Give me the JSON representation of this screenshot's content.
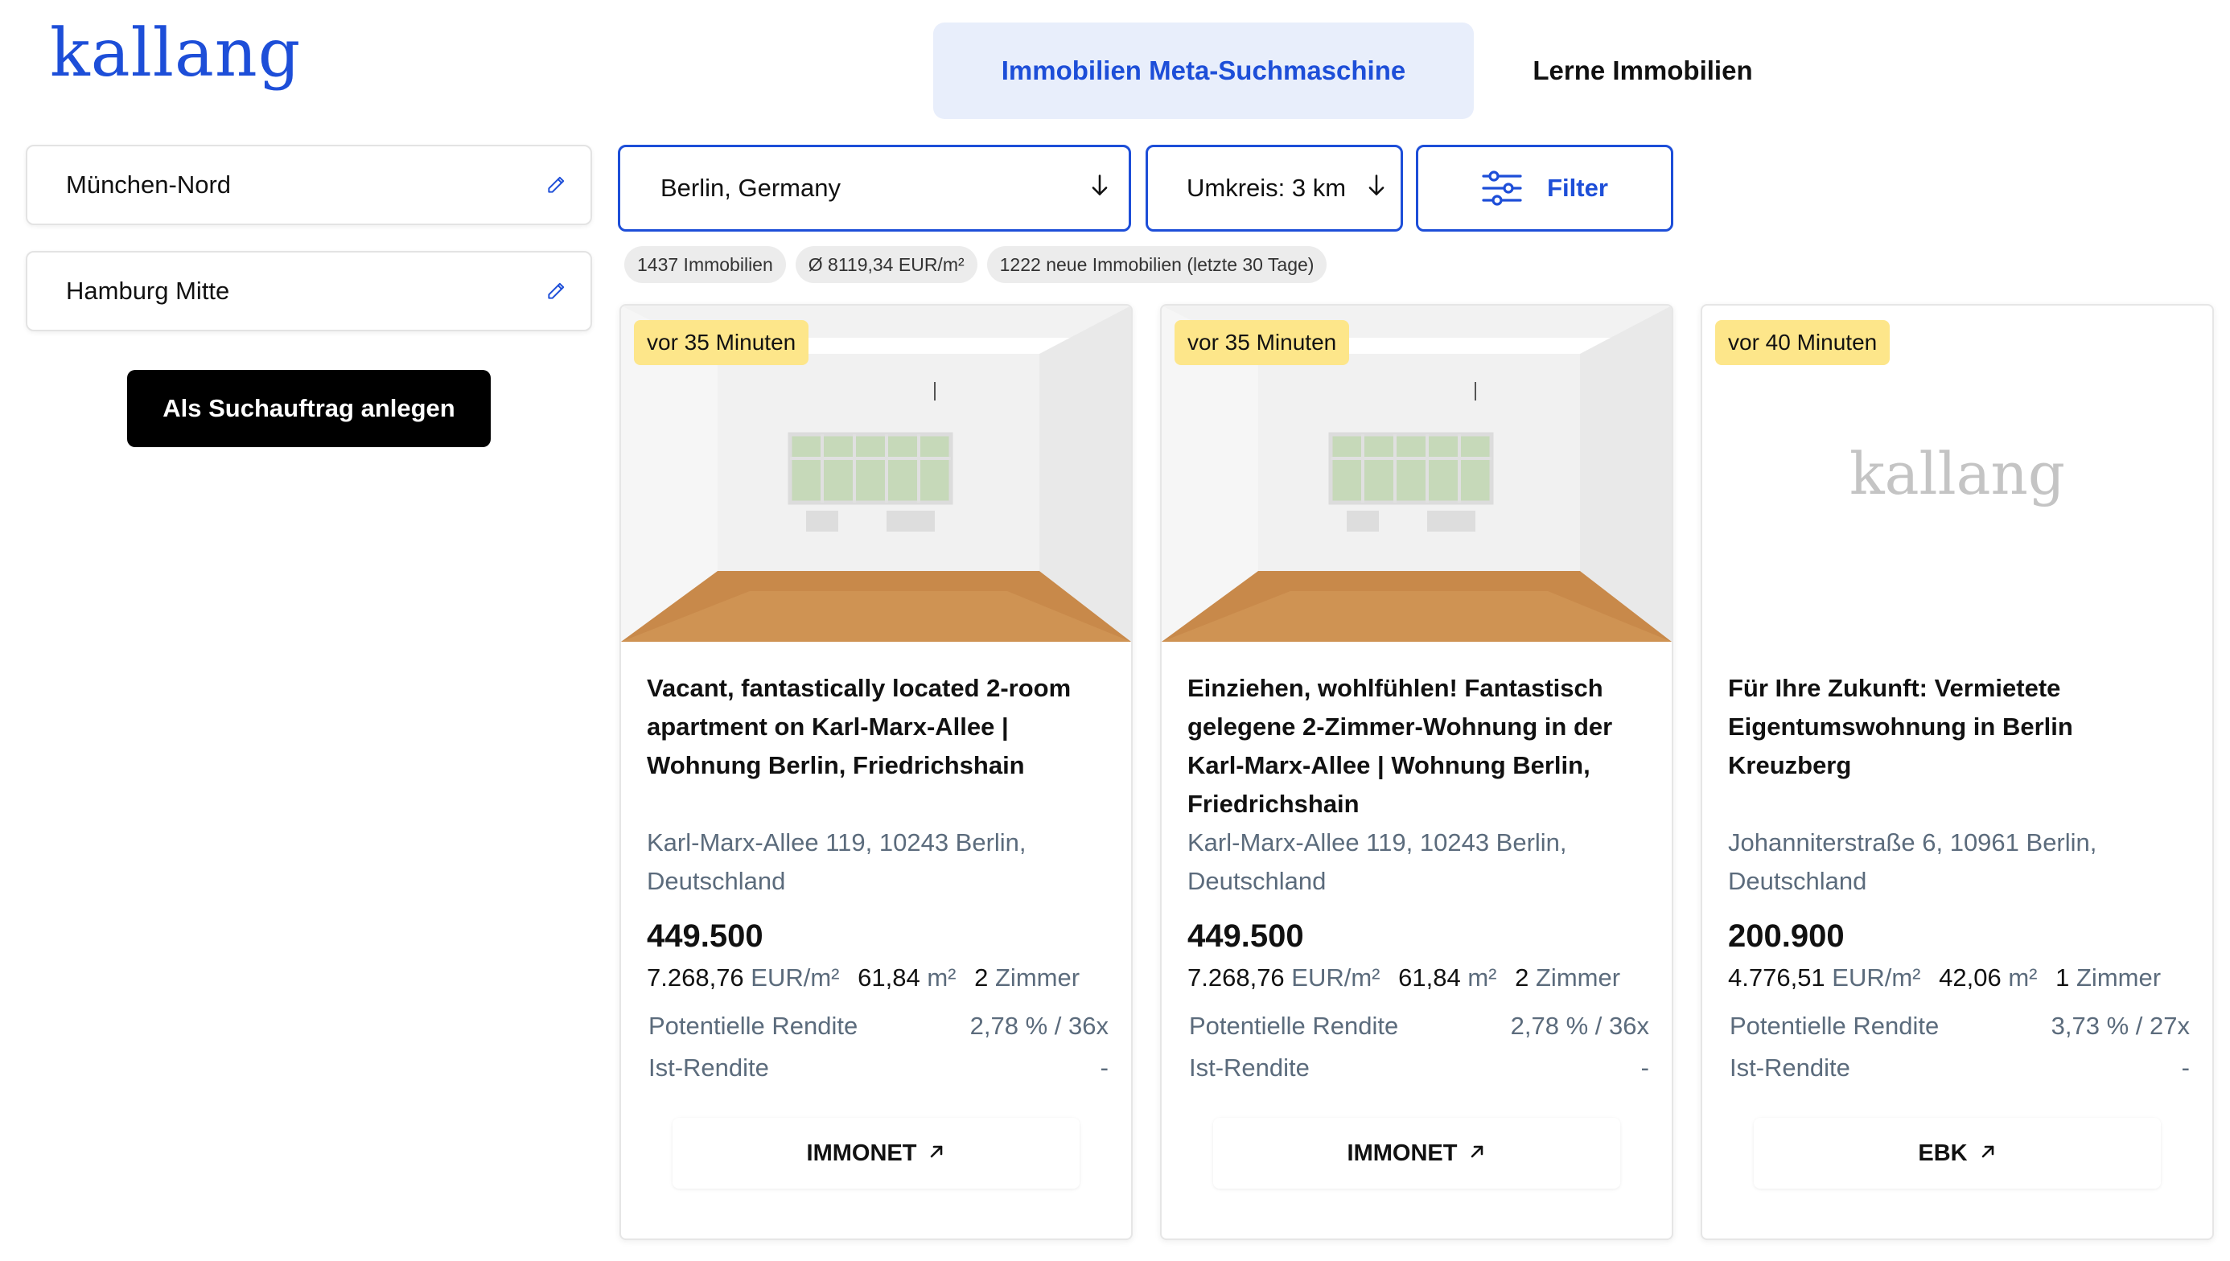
{
  "brand": {
    "logo_text": "kallang",
    "accent": "#1d4ed8"
  },
  "topnav": {
    "tabs": [
      {
        "label": "Immobilien Meta-Suchmaschine",
        "active": true
      },
      {
        "label": "Lerne Immobilien",
        "active": false
      }
    ]
  },
  "sidebar": {
    "saved_searches": [
      {
        "label": "München-Nord",
        "icon": "pencil-icon"
      },
      {
        "label": "Hamburg Mitte",
        "icon": "pencil-icon"
      }
    ],
    "create_button": "Als Suchauftrag anlegen"
  },
  "search": {
    "location": "Berlin, Germany",
    "radius": "Umkreis: 3 km",
    "filter_label": "Filter",
    "stats": [
      "1437 Immobilien",
      "Ø 8119,34 EUR/m²",
      "1222 neue Immobilien (letzte 30 Tage)"
    ]
  },
  "listings": [
    {
      "age": "vor 35 Minuten",
      "image": "empty-room-photo",
      "title": "Vacant, fantastically located 2-room apartment on Karl-Marx-Allee | Wohnung Berlin, Friedrichshain",
      "address": "Karl-Marx-Allee 119, 10243 Berlin, Deutschland",
      "price": "449.500",
      "price_per_sqm": "7.268,76",
      "price_per_sqm_unit": "EUR/m²",
      "area": "61,84",
      "area_unit": "m²",
      "rooms": "2",
      "rooms_unit": "Zimmer",
      "potential_label": "Potentielle Rendite",
      "potential_value": "2,78 % / 36x",
      "actual_label": "Ist-Rendite",
      "actual_value": "-",
      "source": "IMMONET"
    },
    {
      "age": "vor 35 Minuten",
      "image": "empty-room-photo",
      "title": "Einziehen, wohlfühlen! Fantastisch gelegene 2-Zimmer-Wohnung in der Karl-Marx-Allee | Wohnung Berlin, Friedrichshain",
      "address": "Karl-Marx-Allee 119, 10243 Berlin, Deutschland",
      "price": "449.500",
      "price_per_sqm": "7.268,76",
      "price_per_sqm_unit": "EUR/m²",
      "area": "61,84",
      "area_unit": "m²",
      "rooms": "2",
      "rooms_unit": "Zimmer",
      "potential_label": "Potentielle Rendite",
      "potential_value": "2,78 % / 36x",
      "actual_label": "Ist-Rendite",
      "actual_value": "-",
      "source": "IMMONET"
    },
    {
      "age": "vor 40 Minuten",
      "image": "kallang-placeholder-logo",
      "placeholder_text": "kallang",
      "title": "Für Ihre Zukunft: Vermietete Eigentumswohnung in Berlin Kreuzberg",
      "address": "Johanniterstraße 6, 10961 Berlin, Deutschland",
      "price": "200.900",
      "price_per_sqm": "4.776,51",
      "price_per_sqm_unit": "EUR/m²",
      "area": "42,06",
      "area_unit": "m²",
      "rooms": "1",
      "rooms_unit": "Zimmer",
      "potential_label": "Potentielle Rendite",
      "potential_value": "3,73 % / 27x",
      "actual_label": "Ist-Rendite",
      "actual_value": "-",
      "source": "EBK"
    }
  ]
}
